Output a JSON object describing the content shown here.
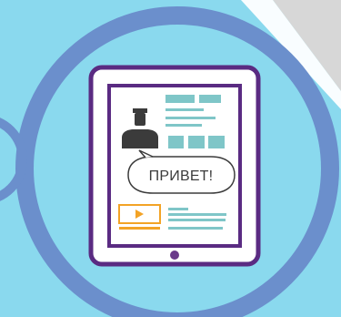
{
  "scene": {
    "speech_bubble_text": "ПРИВЕТ!",
    "colors": {
      "background": "#8ad9ee",
      "ring": "#6b8fcc",
      "tablet_frame": "#5a2b82",
      "tablet_screen": "#ffffff",
      "teal": "#7fc6c8",
      "avatar": "#3b3b3b",
      "video_orange": "#f3a326",
      "home_button": "#6a3a8a",
      "corner_gray": "#d7d7d7"
    },
    "icons": [
      "person-avatar-icon",
      "play-video-icon",
      "tablet-home-button-icon"
    ]
  }
}
